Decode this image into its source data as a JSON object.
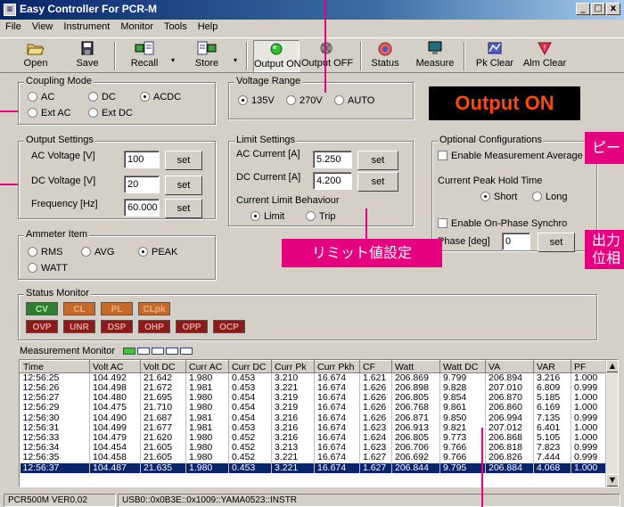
{
  "window": {
    "title": "Easy Controller For PCR-M",
    "controls": [
      "_",
      "□",
      "x"
    ]
  },
  "menu": [
    "File",
    "View",
    "Instrument",
    "Monitor",
    "Tools",
    "Help"
  ],
  "toolbar": {
    "open": "Open",
    "save": "Save",
    "recall": "Recall",
    "store": "Store",
    "output_on": "Output ON",
    "output_off": "Output OFF",
    "status": "Status",
    "measure": "Measure",
    "pk_clear": "Pk Clear",
    "alm_clear": "Alm Clear"
  },
  "coupling": {
    "title": "Coupling Mode",
    "options": [
      "AC",
      "DC",
      "ACDC",
      "Ext AC",
      "Ext DC"
    ],
    "selected": "ACDC"
  },
  "voltage_range": {
    "title": "Voltage Range",
    "options": [
      "135V",
      "270V",
      "AUTO"
    ],
    "selected": "135V"
  },
  "output_banner": "Output ON",
  "output_settings": {
    "title": "Output Settings",
    "ac_label": "AC Voltage [V]",
    "ac_value": "100",
    "dc_label": "DC Voltage [V]",
    "dc_value": "20",
    "freq_label": "Frequency [Hz]",
    "freq_value": "60.000",
    "set": "set"
  },
  "limit_settings": {
    "title": "Limit Settings",
    "ac_label": "AC Current [A]",
    "ac_value": "5.250",
    "dc_label": "DC Current [A]",
    "dc_value": "4.200",
    "behaviour_label": "Current Limit Behaviour",
    "options": [
      "Limit",
      "Trip"
    ],
    "selected": "Limit",
    "set": "set"
  },
  "optional": {
    "title": "Optional Configurations",
    "measurement_average": "Enable Measurement Average",
    "peak_hold_label": "Current Peak Hold Time",
    "peak_options": [
      "Short",
      "Long"
    ],
    "peak_selected": "Short",
    "on_phase": "Enable On-Phase Synchro",
    "phase_label": "Phase [deg]",
    "phase_value": "0",
    "set": "set"
  },
  "ammeter": {
    "title": "Ammeter Item",
    "options": [
      "RMS",
      "AVG",
      "PEAK",
      "WATT"
    ],
    "selected": "PEAK"
  },
  "status_monitor": {
    "title": "Status Monitor",
    "row1": [
      {
        "label": "CV",
        "bg": "#2e7d32",
        "fg": "#b8f0a0"
      },
      {
        "label": "CL",
        "bg": "#c56a2a",
        "fg": "#e8b080"
      },
      {
        "label": "PL",
        "bg": "#c56a2a",
        "fg": "#e8b080"
      },
      {
        "label": "CLpk",
        "bg": "#c56a2a",
        "fg": "#e8b080"
      }
    ],
    "row2": [
      {
        "label": "OVP",
        "bg": "#8b1a1a",
        "fg": "#e0a0a0"
      },
      {
        "label": "UNR",
        "bg": "#8b1a1a",
        "fg": "#e0a0a0"
      },
      {
        "label": "DSP",
        "bg": "#8b1a1a",
        "fg": "#e0a0a0"
      },
      {
        "label": "OHP",
        "bg": "#8b1a1a",
        "fg": "#e0a0a0"
      },
      {
        "label": "OPP",
        "bg": "#8b1a1a",
        "fg": "#e0a0a0"
      },
      {
        "label": "OCP",
        "bg": "#8b1a1a",
        "fg": "#e0a0a0"
      }
    ]
  },
  "measurement": {
    "title": "Measurement Monitor",
    "columns": [
      "Time",
      "Volt AC",
      "Volt DC",
      "Curr AC",
      "Curr DC",
      "Curr Pk",
      "Curr Pkh",
      "CF",
      "Watt",
      "Watt DC",
      "VA",
      "VAR",
      "PF"
    ],
    "rows": [
      [
        "12:56:25",
        "104.492",
        "21.642",
        "1.980",
        "0.453",
        "3.210",
        "16.674",
        "1.621",
        "206.869",
        "9.799",
        "206.894",
        "3.216",
        "1.000"
      ],
      [
        "12:56:26",
        "104.498",
        "21.672",
        "1.981",
        "0.453",
        "3.221",
        "16.674",
        "1.626",
        "206.898",
        "9.828",
        "207.010",
        "6.809",
        "0.999"
      ],
      [
        "12:56:27",
        "104.480",
        "21.695",
        "1.980",
        "0.454",
        "3.219",
        "16.674",
        "1.626",
        "206.805",
        "9.854",
        "206.870",
        "5.185",
        "1.000"
      ],
      [
        "12:56:29",
        "104.475",
        "21.710",
        "1.980",
        "0.454",
        "3.219",
        "16.674",
        "1.626",
        "206.768",
        "9.861",
        "206.860",
        "6.169",
        "1.000"
      ],
      [
        "12:56:30",
        "104.490",
        "21.687",
        "1.981",
        "0.454",
        "3.216",
        "16.674",
        "1.626",
        "206.871",
        "9.850",
        "206.994",
        "7.135",
        "0.999"
      ],
      [
        "12:56:31",
        "104.499",
        "21.677",
        "1.981",
        "0.453",
        "3.216",
        "16.674",
        "1.623",
        "206.913",
        "9.821",
        "207.012",
        "6.401",
        "1.000"
      ],
      [
        "12:56:33",
        "104.479",
        "21.620",
        "1.980",
        "0.452",
        "3.216",
        "16.674",
        "1.624",
        "206.805",
        "9.773",
        "206.868",
        "5.105",
        "1.000"
      ],
      [
        "12:56:34",
        "104.454",
        "21.605",
        "1.980",
        "0.452",
        "3.213",
        "16.674",
        "1.623",
        "206.706",
        "9.766",
        "206.818",
        "7.823",
        "0.999"
      ],
      [
        "12:56:35",
        "104.458",
        "21.605",
        "1.980",
        "0.452",
        "3.221",
        "16.674",
        "1.627",
        "206.692",
        "9.766",
        "206.826",
        "7.444",
        "0.999"
      ],
      [
        "12:56:37",
        "104.487",
        "21.635",
        "1.980",
        "0.453",
        "3.221",
        "16.674",
        "1.627",
        "206.844",
        "9.795",
        "206.884",
        "4.068",
        "1.000"
      ]
    ],
    "selected_row": 9
  },
  "statusbar": {
    "version": "PCR500M VER0.02",
    "resource": "USB0::0x0B3E::0x1009::YAMA0523::INSTR"
  },
  "annotations": {
    "limit_callout": "リミット値設定",
    "peak_callout": "ピー",
    "output_phase_callout_1": "出力",
    "output_phase_callout_2": "位相"
  },
  "colors": {
    "annotation": "#e4007f",
    "output_on_text": "#ff4a00",
    "selection": "#0a246a"
  }
}
